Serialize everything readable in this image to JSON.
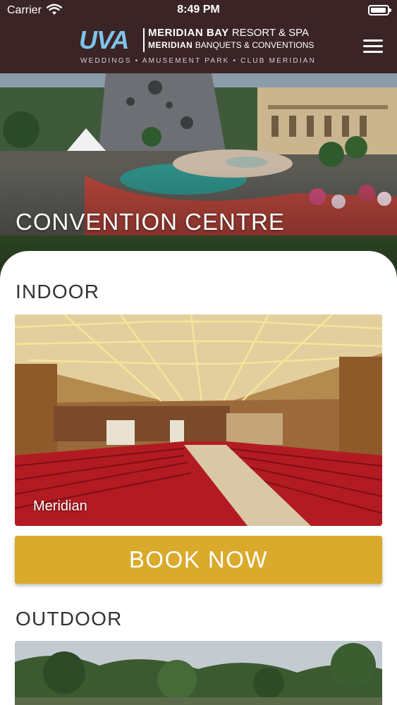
{
  "status_bar": {
    "carrier": "Carrier",
    "time": "8:49 PM"
  },
  "header": {
    "logo_uva": "UVA",
    "logo_line1_bold": "MERIDIAN BAY",
    "logo_line1_rest": "RESORT & SPA",
    "logo_line2_bold": "MERIDIAN",
    "logo_line2_rest": "BANQUETS & CONVENTIONS",
    "logo_tagline": "WEDDINGS • AMUSEMENT PARK • CLUB MERIDIAN",
    "menu_icon": "hamburger-menu-icon"
  },
  "hero": {
    "title": "CONVENTION CENTRE"
  },
  "sections": [
    {
      "title": "INDOOR",
      "caption": "Meridian",
      "button_label": "BOOK NOW"
    },
    {
      "title": "OUTDOOR"
    }
  ],
  "colors": {
    "header_bg": "#3a2426",
    "button_gold": "#d9aa2b",
    "logo_blue": "#7fc3e8"
  }
}
